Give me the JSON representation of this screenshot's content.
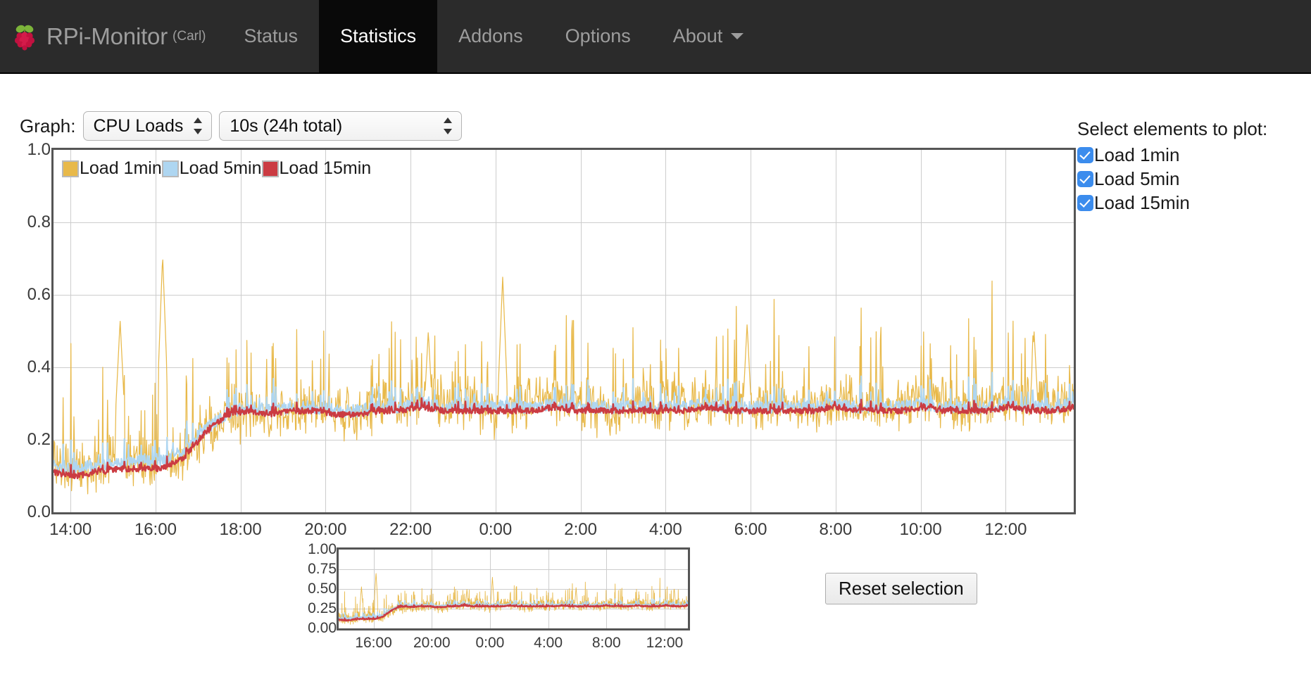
{
  "navbar": {
    "logo_icon": "raspberry-pi-logo",
    "brand": "RPi-Monitor",
    "brand_suffix": "(Carl)",
    "items": [
      {
        "label": "Status",
        "active": false
      },
      {
        "label": "Statistics",
        "active": true
      },
      {
        "label": "Addons",
        "active": false
      },
      {
        "label": "Options",
        "active": false
      },
      {
        "label": "About",
        "active": false,
        "caret": true
      }
    ]
  },
  "controls": {
    "graph_label": "Graph:",
    "graph_select": {
      "value": "CPU Loads",
      "options": [
        "CPU Loads"
      ]
    },
    "interval_select": {
      "value": "10s (24h total)",
      "options": [
        "10s (24h total)"
      ]
    }
  },
  "plot_select": {
    "title": "Select elements to plot:",
    "items": [
      {
        "label": "Load 1min",
        "checked": true
      },
      {
        "label": "Load 5min",
        "checked": true
      },
      {
        "label": "Load 15min",
        "checked": true
      }
    ],
    "checkbox_color": "#3b8ced"
  },
  "reset_button": {
    "label": "Reset selection"
  },
  "chart_data": {
    "type": "line",
    "title": "",
    "xlabel": "",
    "ylabel": "",
    "ylim": [
      0.0,
      1.0
    ],
    "yticks": [
      "1.0",
      "0.8",
      "0.6",
      "0.4",
      "0.2",
      "0.0"
    ],
    "ytick_values": [
      1.0,
      0.8,
      0.6,
      0.4,
      0.2,
      0.0
    ],
    "xticks": [
      "14:00",
      "16:00",
      "18:00",
      "20:00",
      "22:00",
      "0:00",
      "2:00",
      "4:00",
      "6:00",
      "8:00",
      "10:00",
      "12:00"
    ],
    "xtick_hours": [
      14,
      16,
      18,
      20,
      22,
      24,
      26,
      28,
      30,
      32,
      34,
      36
    ],
    "x_range_hours": [
      13.6,
      37.6
    ],
    "grid": true,
    "legend_position": "top-left",
    "legend": [
      {
        "name": "Load 1min",
        "color": "#e8b94a"
      },
      {
        "name": "Load 5min",
        "color": "#aed6f1"
      },
      {
        "name": "Load 15min",
        "color": "#cb3b42"
      }
    ],
    "series": [
      {
        "name": "Load 1min",
        "color": "#e8b94a",
        "note": "noisy 1-minute load average; frequent spikes to 0.35-0.55, maxima 0.71 near 16:10 and 0.65 near 0:10",
        "baseline_values": [
          0.14,
          0.12,
          0.13,
          0.15,
          0.14,
          0.13,
          0.16,
          0.22,
          0.26,
          0.28,
          0.27,
          0.29,
          0.3,
          0.28,
          0.27,
          0.3,
          0.29,
          0.31,
          0.3,
          0.29,
          0.28,
          0.29,
          0.3,
          0.31,
          0.3,
          0.29,
          0.28,
          0.3,
          0.29,
          0.3,
          0.31,
          0.3,
          0.29,
          0.3,
          0.29,
          0.3,
          0.31,
          0.3,
          0.29,
          0.3,
          0.31,
          0.3,
          0.29,
          0.3,
          0.31,
          0.3,
          0.29,
          0.3
        ],
        "peaks": [
          {
            "time": "16:10",
            "value": 0.71
          },
          {
            "time": "15:10",
            "value": 0.53
          },
          {
            "time": "0:10",
            "value": 0.65
          },
          {
            "time": "5:55",
            "value": 0.52
          },
          {
            "time": "22:25",
            "value": 0.5
          },
          {
            "time": "12:40",
            "value": 0.5
          }
        ],
        "min": 0.08,
        "max": 0.71
      },
      {
        "name": "Load 5min",
        "color": "#aed6f1",
        "note": "5-minute load average, smoother band following the 1min trend",
        "baseline_values": [
          0.13,
          0.12,
          0.13,
          0.14,
          0.14,
          0.14,
          0.17,
          0.23,
          0.27,
          0.29,
          0.28,
          0.29,
          0.29,
          0.28,
          0.28,
          0.29,
          0.29,
          0.3,
          0.29,
          0.29,
          0.29,
          0.29,
          0.29,
          0.3,
          0.29,
          0.29,
          0.29,
          0.29,
          0.29,
          0.29,
          0.3,
          0.29,
          0.29,
          0.29,
          0.29,
          0.29,
          0.3,
          0.29,
          0.29,
          0.29,
          0.3,
          0.29,
          0.29,
          0.29,
          0.3,
          0.29,
          0.29,
          0.3
        ],
        "min": 0.1,
        "max": 0.42
      },
      {
        "name": "Load 15min",
        "color": "#cb3b42",
        "note": "15-minute load average, smoothest line, mostly flat around 0.27-0.29 after 15:00",
        "baseline_values": [
          0.11,
          0.1,
          0.11,
          0.12,
          0.12,
          0.12,
          0.15,
          0.22,
          0.27,
          0.28,
          0.27,
          0.28,
          0.28,
          0.27,
          0.27,
          0.28,
          0.28,
          0.29,
          0.28,
          0.28,
          0.28,
          0.28,
          0.28,
          0.29,
          0.28,
          0.28,
          0.28,
          0.28,
          0.28,
          0.28,
          0.29,
          0.28,
          0.28,
          0.28,
          0.28,
          0.28,
          0.29,
          0.28,
          0.28,
          0.28,
          0.29,
          0.28,
          0.28,
          0.28,
          0.29,
          0.28,
          0.28,
          0.29
        ],
        "min": 0.1,
        "max": 0.31
      }
    ]
  },
  "mini_chart_data": {
    "type": "line",
    "ylim": [
      0.0,
      1.0
    ],
    "yticks": [
      "1.00",
      "0.75",
      "0.50",
      "0.25",
      "0.00"
    ],
    "ytick_values": [
      1.0,
      0.75,
      0.5,
      0.25,
      0.0
    ],
    "xticks": [
      "16:00",
      "20:00",
      "0:00",
      "4:00",
      "8:00",
      "12:00"
    ],
    "xtick_hours": [
      16,
      20,
      24,
      28,
      32,
      36
    ],
    "x_range_hours": [
      13.6,
      37.6
    ],
    "grid": true,
    "series": [
      {
        "name": "Load 1min",
        "color": "#e8b94a"
      },
      {
        "name": "Load 5min",
        "color": "#aed6f1"
      },
      {
        "name": "Load 15min",
        "color": "#cb3b42"
      }
    ]
  }
}
